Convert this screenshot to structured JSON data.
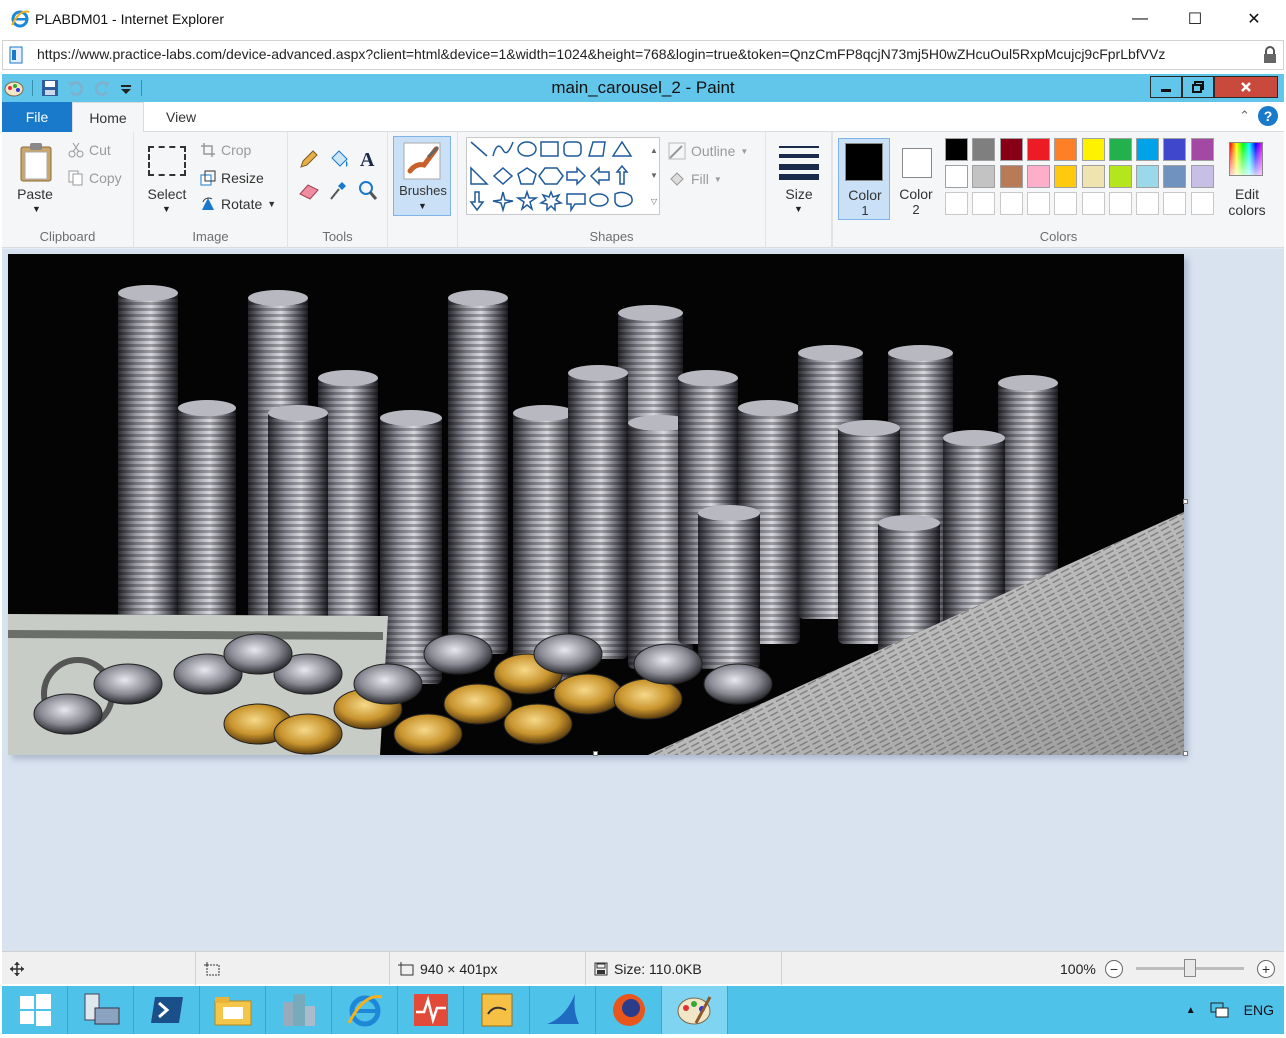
{
  "ie": {
    "title": "PLABDM01 - Internet Explorer",
    "url": "https://www.practice-labs.com/device-advanced.aspx?client=html&device=1&width=1024&height=768&login=true&token=QnzCmFP8qcjN73mj5H0wZHcuOul5RxpMcujcj9cFprLbfVVz",
    "minimize": "—",
    "maximize": "☐",
    "close": "✕"
  },
  "paint": {
    "title": "main_carousel_2 - Paint",
    "tabs": {
      "file": "File",
      "home": "Home",
      "view": "View"
    },
    "clipboard": {
      "label": "Clipboard",
      "paste": "Paste",
      "cut": "Cut",
      "copy": "Copy"
    },
    "image": {
      "label": "Image",
      "select": "Select",
      "crop": "Crop",
      "resize": "Resize",
      "rotate": "Rotate"
    },
    "tools": {
      "label": "Tools"
    },
    "brushes": {
      "label": "Brushes"
    },
    "shapes": {
      "label": "Shapes",
      "outline": "Outline",
      "fill": "Fill"
    },
    "size": {
      "label": "Size"
    },
    "color1": {
      "label": "Color",
      "num": "1",
      "value": "#000000"
    },
    "color2": {
      "label": "Color",
      "num": "2",
      "value": "#ffffff"
    },
    "colors": {
      "label": "Colors",
      "edit_label": "Edit",
      "edit_label2": "colors",
      "palette_row1": [
        "#000000",
        "#7f7f7f",
        "#880015",
        "#ed1c24",
        "#ff7f27",
        "#fff200",
        "#22b14c",
        "#00a2e8",
        "#3f48cc",
        "#a349a4"
      ],
      "palette_row2": [
        "#ffffff",
        "#c3c3c3",
        "#b97a57",
        "#ffaec9",
        "#ffc90e",
        "#efe4b0",
        "#b5e61d",
        "#99d9ea",
        "#7092be",
        "#c8bfe7"
      ]
    }
  },
  "status": {
    "dimensions": "940 × 401px",
    "size": "Size: 110.0KB",
    "zoom": "100%",
    "zoom_level": 1.0
  },
  "taskbar": {
    "language": "ENG"
  }
}
